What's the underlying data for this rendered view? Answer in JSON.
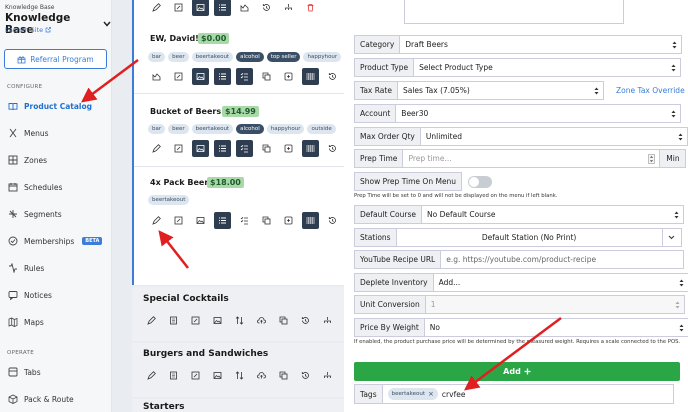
{
  "sidebar": {
    "kb_small": "Knowledge Base",
    "kb_title": "Knowledge Base",
    "launch_site": "Launch Site",
    "referral": "Referral Program",
    "configure_head": "CONFIGURE",
    "operate_head": "OPERATE",
    "items": [
      {
        "label": "Product Catalog",
        "icon": "book-icon"
      },
      {
        "label": "Menus",
        "icon": "utensils-icon"
      },
      {
        "label": "Zones",
        "icon": "grid-icon"
      },
      {
        "label": "Schedules",
        "icon": "calendar-icon"
      },
      {
        "label": "Segments",
        "icon": "segments-icon"
      },
      {
        "label": "Memberships",
        "icon": "membership-icon",
        "badge": "BETA"
      },
      {
        "label": "Rules",
        "icon": "rules-icon"
      },
      {
        "label": "Notices",
        "icon": "notice-icon"
      },
      {
        "label": "Maps",
        "icon": "map-icon"
      },
      {
        "label": "Tabs",
        "icon": "tabs-icon"
      },
      {
        "label": "Pack & Route",
        "icon": "package-icon"
      }
    ]
  },
  "products": [
    {
      "name": "EW, David!",
      "price": "$0.00",
      "tags": [
        "bar",
        "beer",
        "beertakeout",
        "alcohol",
        "top seller",
        "happyhour"
      ]
    },
    {
      "name": "Bucket of Beers!",
      "price": "$14.99",
      "tags": [
        "bar",
        "beer",
        "beertakeout",
        "alcohol",
        "happyhour",
        "outside"
      ]
    },
    {
      "name": "4x Pack Beer",
      "price": "$18.00",
      "tags": [
        "beertakeout"
      ]
    }
  ],
  "categories": [
    {
      "name": "Special Cocktails"
    },
    {
      "name": "Burgers and Sandwiches"
    },
    {
      "name": "Starters"
    }
  ],
  "form": {
    "category_label": "Category",
    "category_value": "Draft Beers",
    "product_type_label": "Product Type",
    "product_type_value": "Select Product Type",
    "tax_rate_label": "Tax Rate",
    "tax_rate_value": "Sales Tax (7.05%)",
    "zone_tax_override": "Zone Tax Override",
    "account_label": "Account",
    "account_value": "Beer30",
    "max_order_label": "Max Order Qty",
    "max_order_value": "Unlimited",
    "prep_time_label": "Prep Time",
    "prep_time_placeholder": "Prep time...",
    "prep_time_unit": "Min",
    "show_prep_label": "Show Prep Time On Menu",
    "prep_hint": "Prep Time will be set to 0 and will not be displayed on the menu if left blank.",
    "default_course_label": "Default Course",
    "default_course_value": "No Default Course",
    "stations_label": "Stations",
    "stations_value": "Default Station (No Print)",
    "youtube_label": "YouTube Recipe URL",
    "youtube_placeholder": "e.g. https://youtube.com/product-recipe",
    "deplete_label": "Deplete Inventory",
    "deplete_value": "Add...",
    "unit_conv_label": "Unit Conversion",
    "unit_conv_value": "1",
    "price_weight_label": "Price By Weight",
    "price_weight_value": "No",
    "weight_hint": "If enabled, the product purchase price will be determined by the measured weight. Requires a scale connected to the POS.",
    "add_label": "Add",
    "tags_label": "Tags",
    "tag_chip": "beertakeout",
    "tag_typed": "crvfee"
  },
  "colors": {
    "accent": "#3b7dd8",
    "price_bg": "#a9d9a9",
    "add_green": "#2aa647",
    "annotation_red": "#e02020"
  }
}
